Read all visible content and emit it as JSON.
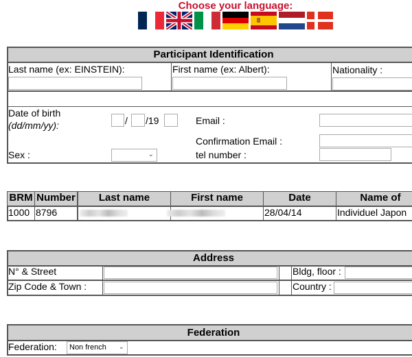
{
  "language": {
    "title": "Choose your language:",
    "flags": [
      "flag-france",
      "flag-uk",
      "flag-italy",
      "flag-germany",
      "flag-spain",
      "flag-netherlands",
      "flag-denmark"
    ]
  },
  "participant": {
    "header": "Participant Identification",
    "last_name_label": "Last name (ex: EINSTEIN):",
    "first_name_label": "First name (ex: Albert):",
    "nationality_label": "Nationality :",
    "dob_label": "Date of birth",
    "dob_format": "(dd/mm/yy):",
    "dob_sep": "/",
    "dob_century": "/19",
    "email_label": "Email :",
    "confirm_email_label": "Confirmation Email :",
    "tel_label": "tel number :",
    "sex_label": "Sex :",
    "sex_value": ""
  },
  "brm": {
    "headers": [
      "BRM",
      "Number",
      "Last name",
      "First name",
      "Date",
      "Name of"
    ],
    "row": {
      "brm": "1000",
      "number": "8796",
      "date": "28/04/14",
      "name_of": "Individuel Japon"
    }
  },
  "address": {
    "header": "Address",
    "street_label": "N° & Street",
    "zip_label": "Zip Code & Town :",
    "bldg_label": "Bldg, floor :",
    "country_label": "Country :"
  },
  "federation": {
    "header": "Federation",
    "label": "Federation:",
    "value": "Non french"
  },
  "colors": {
    "title": "#c8102e",
    "header_bg": "#d0d0d0"
  }
}
